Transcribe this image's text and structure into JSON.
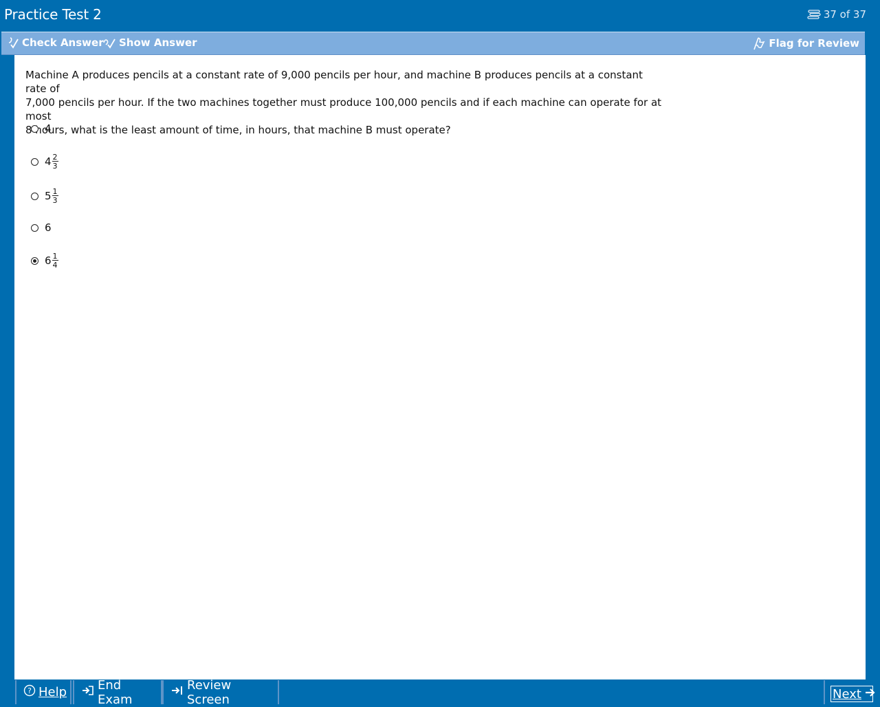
{
  "window": {
    "title": "Practice Test 2",
    "counter": "37 of 37"
  },
  "toolbar": {
    "check_answer": "Check Answer",
    "show_answer": "Show Answer",
    "flag_for_review": "Flag for Review"
  },
  "question": {
    "text": "Machine A produces pencils at a constant rate of 9,000 pencils per hour, and machine B produces pencils at a constant rate of\n7,000 pencils per hour.  If the two machines together must produce 100,000 pencils and if each machine can operate for at most\n8 hours, what is the least amount of time, in hours, that machine B must operate?",
    "choices": [
      {
        "whole": "4",
        "num": "",
        "den": "",
        "selected": false
      },
      {
        "whole": "4",
        "num": "2",
        "den": "3",
        "selected": false
      },
      {
        "whole": "5",
        "num": "1",
        "den": "3",
        "selected": false
      },
      {
        "whole": "6",
        "num": "",
        "den": "",
        "selected": false
      },
      {
        "whole": "6",
        "num": "1",
        "den": "4",
        "selected": true
      }
    ]
  },
  "footer": {
    "help": "Help",
    "end_exam": "End Exam",
    "review_screen": "Review Screen",
    "next": "Next"
  },
  "colors": {
    "frame_blue": "#006db0",
    "toolbar_blue": "#7eadde",
    "panel": "#ffffff"
  }
}
